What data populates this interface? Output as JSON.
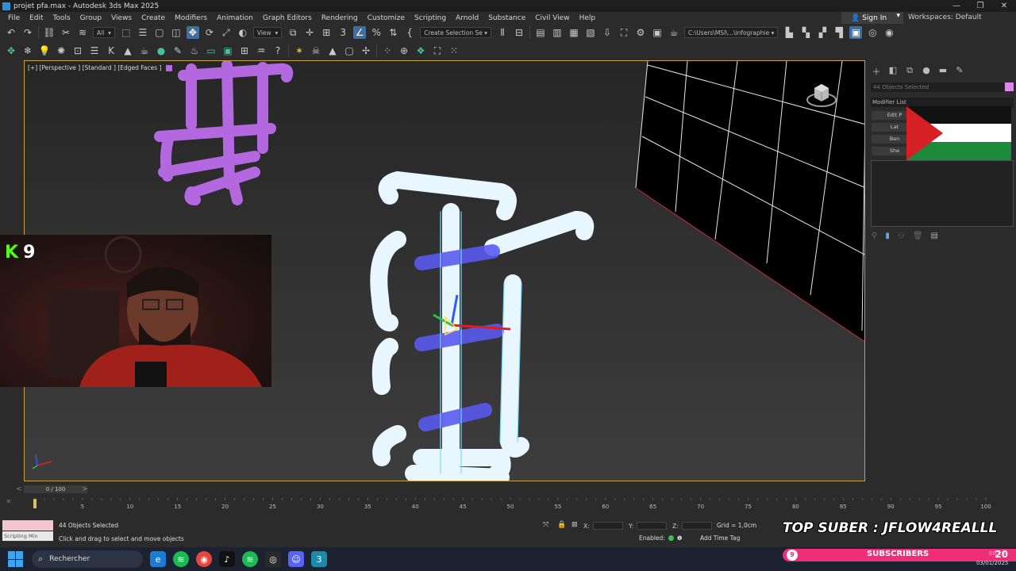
{
  "window": {
    "title": "projet pfa.max - Autodesk 3ds Max 2025",
    "controls": [
      "—",
      "❐",
      "✕"
    ]
  },
  "menu": [
    "File",
    "Edit",
    "Tools",
    "Group",
    "Views",
    "Create",
    "Modifiers",
    "Animation",
    "Graph Editors",
    "Rendering",
    "Customize",
    "Scripting",
    "Arnold",
    "Substance",
    "Civil View",
    "Help"
  ],
  "account": {
    "sign_in": "Sign In",
    "workspaces_label": "Workspaces: Default"
  },
  "toolbar": {
    "selection_filter": "All",
    "ref_coord": "View",
    "named_selection": "Create Selection Se",
    "project_path": "C:\\Users\\MSI\\...\\infographie"
  },
  "viewport": {
    "label": "[+] [Perspective ] [Standard ] [Edged Faces ]",
    "selection_color": "#b468e0",
    "wire_color": "#ffffff",
    "highlight_color": "#5a5af0"
  },
  "overlay": {
    "kick_count": "9",
    "kick_color": "#53fc18"
  },
  "command_panel": {
    "selection_field": "44 Objects Selected",
    "modifier_list": "Modifier List",
    "modifiers": [
      "Edit P",
      "Lat",
      "Ben",
      "She"
    ],
    "object_color": "#d88ae8"
  },
  "timeline": {
    "frame_display": "0 / 100",
    "ticks": [
      "0",
      "5",
      "10",
      "15",
      "20",
      "25",
      "30",
      "35",
      "40",
      "45",
      "50",
      "55",
      "60",
      "65",
      "70",
      "75",
      "80",
      "85",
      "90",
      "95",
      "100"
    ]
  },
  "status": {
    "selected": "44 Objects Selected",
    "prompt": "Click and drag to select and move objects",
    "x_label": "X:",
    "y_label": "Y:",
    "z_label": "Z:",
    "grid": "Grid = 1,0cm",
    "enabled": "Enabled:",
    "add_time_tag": "Add Time Tag",
    "maxscript_label": "Scripting Min"
  },
  "stream": {
    "top_suber": "TOP SUBER : JFLOW4REALLL",
    "sub_badge": "9",
    "subscribers_label": "SUBSCRIBERS",
    "subscribers_count": "20"
  },
  "taskbar": {
    "search_placeholder": "Rechercher",
    "time": "00:20",
    "date": "03/01/2025"
  }
}
